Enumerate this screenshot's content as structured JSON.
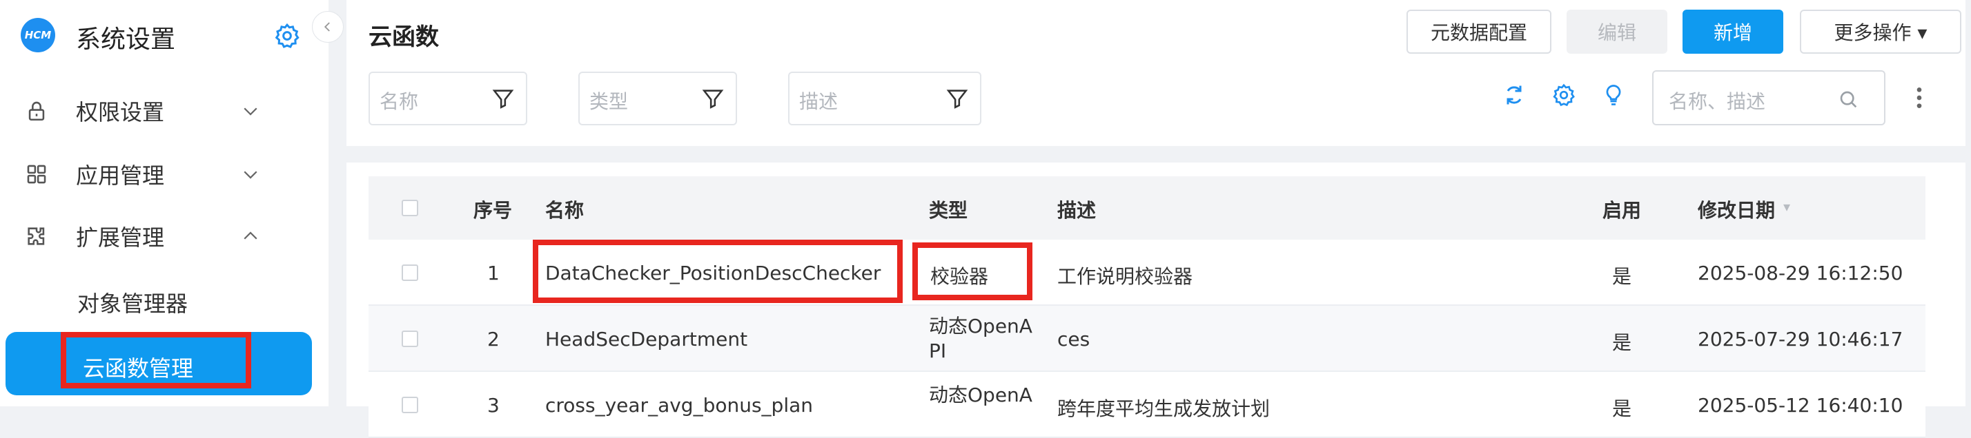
{
  "sidebar": {
    "logo_text": "HCM",
    "title": "系统设置",
    "menu": [
      {
        "label": "权限设置",
        "icon": "lock-icon",
        "expanded": false
      },
      {
        "label": "应用管理",
        "icon": "grid-icon",
        "expanded": false
      },
      {
        "label": "扩展管理",
        "icon": "puzzle-icon",
        "expanded": true
      }
    ],
    "sub_items": [
      "对象管理器",
      "云函数管理"
    ],
    "active_item": "云函数管理"
  },
  "header": {
    "title": "云函数",
    "buttons": {
      "metadata_config": "元数据配置",
      "edit": "编辑",
      "add": "新增",
      "more": "更多操作 ▾"
    },
    "filters": {
      "name_placeholder": "名称",
      "type_placeholder": "类型",
      "desc_placeholder": "描述"
    },
    "search_placeholder": "名称、描述"
  },
  "table": {
    "columns": {
      "index": "序号",
      "name": "名称",
      "type": "类型",
      "desc": "描述",
      "enabled": "启用",
      "modified": "修改日期",
      "sort_indicator": "▾"
    },
    "rows": [
      {
        "index": "1",
        "name": "DataChecker_PositionDescChecker",
        "type": "校验器",
        "desc": "工作说明校验器",
        "enabled": "是",
        "modified": "2025-08-29 16:12:50"
      },
      {
        "index": "2",
        "name": "HeadSecDepartment",
        "type": "动态OpenAPI",
        "desc": "ces",
        "enabled": "是",
        "modified": "2025-07-29 10:46:17"
      },
      {
        "index": "3",
        "name": "cross_year_avg_bonus_plan",
        "type": "动态OpenA",
        "desc": "跨年度平均生成发放计划",
        "enabled": "是",
        "modified": "2025-05-12 16:40:10"
      }
    ]
  },
  "colors": {
    "primary": "#0f9af0",
    "highlight": "#e8261f",
    "background": "#f0f2f5"
  }
}
